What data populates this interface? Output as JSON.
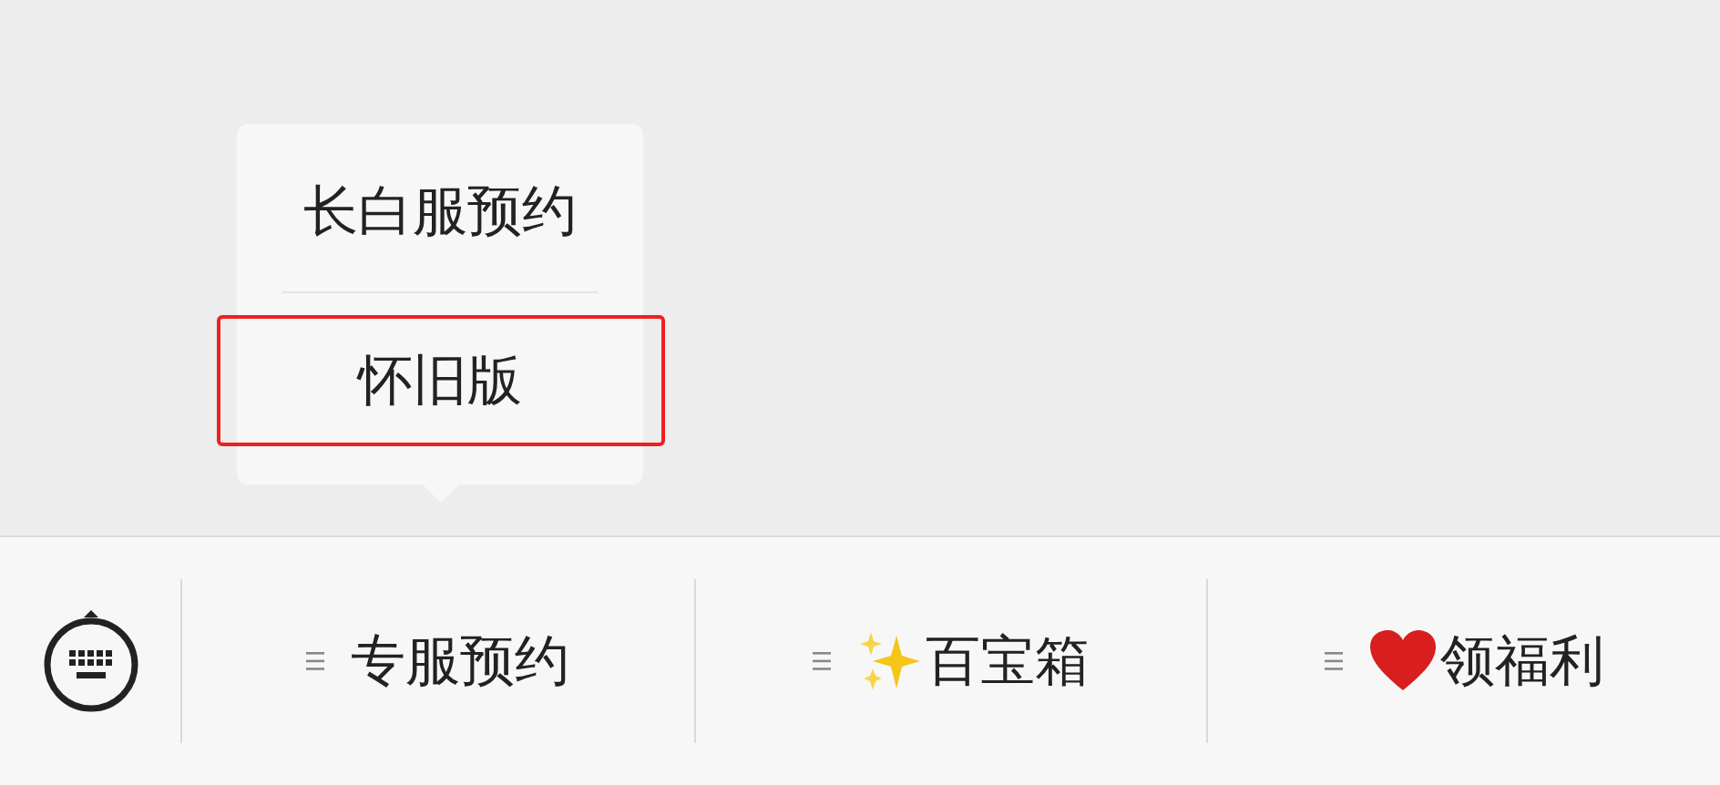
{
  "submenu": {
    "items": [
      {
        "label": "长白服预约",
        "highlighted": false
      },
      {
        "label": "怀旧版",
        "highlighted": true
      }
    ]
  },
  "menu_bar": {
    "items": [
      {
        "label": "专服预约",
        "kind": "plain"
      },
      {
        "label": "百宝箱",
        "kind": "sparkles"
      },
      {
        "label": "领福利",
        "kind": "heart"
      }
    ]
  }
}
